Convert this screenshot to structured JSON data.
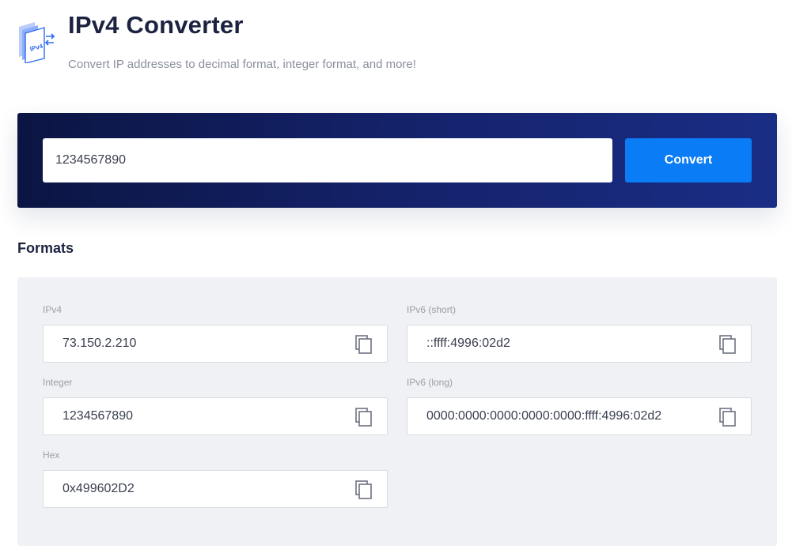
{
  "header": {
    "title": "IPv4 Converter",
    "subtitle": "Convert IP addresses to decimal format, integer format, and more!",
    "logo_text": "IPv4",
    "logo_icon": "ipv4-logo-icon"
  },
  "converter": {
    "input_value": "1234567890",
    "button_label": "Convert"
  },
  "formats": {
    "heading": "Formats",
    "ipv4": {
      "label": "IPv4",
      "value": "73.150.2.210"
    },
    "integer": {
      "label": "Integer",
      "value": "1234567890"
    },
    "hex": {
      "label": "Hex",
      "value": "0x499602D2"
    },
    "ipv6_short": {
      "label": "IPv6 (short)",
      "value": "::ffff:4996:02d2"
    },
    "ipv6_long": {
      "label": "IPv6 (long)",
      "value": "0000:0000:0000:0000:0000:ffff:4996:02d2"
    },
    "copy_icon": "copy-icon"
  },
  "colors": {
    "accent": "#0a7cf6",
    "banner_start": "#0b1543",
    "banner_end": "#1a2d85",
    "panel_bg": "#f0f1f4",
    "title": "#1c2340"
  }
}
